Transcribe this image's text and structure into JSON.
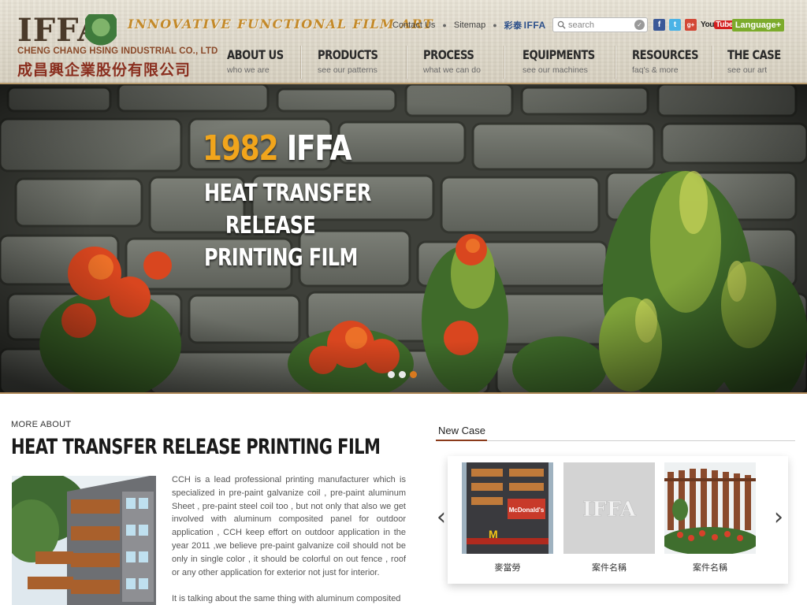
{
  "brand": {
    "logo_text": "IFFA",
    "company_en": "CHENG CHANG HSING INDUSTRIAL CO., LTD",
    "company_zh": "成昌興企業股份有限公司",
    "tagline": "INNOVATIVE FUNCTIONAL FILM ART"
  },
  "toplinks": {
    "contact": "Contact Us",
    "sitemap": "Sitemap",
    "brand_cn": "彩泰",
    "brand_en": "IFFA"
  },
  "search": {
    "placeholder": "search"
  },
  "social": {
    "facebook": "f",
    "twitter": "t",
    "googleplus": "g+",
    "youtube_you": "You",
    "youtube_tube": "Tube"
  },
  "language_label": "Language+",
  "nav": [
    {
      "title": "ABOUT US",
      "sub": "who we are"
    },
    {
      "title": "PRODUCTS",
      "sub": "see our patterns"
    },
    {
      "title": "PROCESS",
      "sub": "what we can do"
    },
    {
      "title": "EQUIPMENTS",
      "sub": "see our machines"
    },
    {
      "title": "RESOURCES",
      "sub": "faq's & more"
    },
    {
      "title": "THE CASE",
      "sub": "see our art"
    }
  ],
  "hero": {
    "year": "1982",
    "brand": "IFFA",
    "line1": "HEAT TRANSFER",
    "line2": "RELEASE",
    "line3": "PRINTING FILM",
    "slides": 3,
    "active_slide": 3
  },
  "about": {
    "kicker": "MORE ABOUT",
    "title": "HEAT TRANSFER RELEASE PRINTING FILM",
    "para1": "CCH is a lead professional printing manufacturer which is specialized in pre-paint galvanize coil , pre-paint aluminum Sheet , pre-paint steel coil too , but not only that also we get involved with aluminum composited panel for outdoor application , CCH keep effort on outdoor application in the year 2011 ,we believe pre-paint galvanize coil should not be only in single color , it should be colorful on out fence , roof or any other application for exterior not just for interior.",
    "para2": "It is talking about the same thing with aluminum composited"
  },
  "newcase": {
    "title": "New Case",
    "items": [
      {
        "label": "麥當勞",
        "sign": "McDonald's"
      },
      {
        "label": "案件名稱",
        "sign": "IFFA"
      },
      {
        "label": "案件名稱",
        "sign": ""
      }
    ]
  },
  "colors": {
    "accent_orange": "#d9791f",
    "nav_border": "#b79a6c",
    "language_green": "#7cab2c",
    "logo_red": "#8a2f1f"
  }
}
